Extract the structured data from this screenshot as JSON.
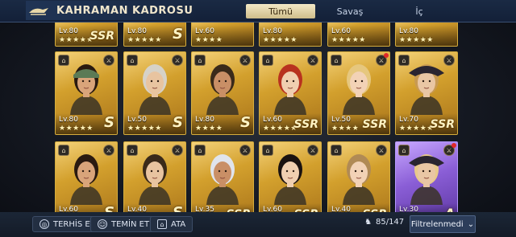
{
  "header": {
    "title": "KAHRAMAN KADROSU"
  },
  "tabs": [
    {
      "label": "Tümü",
      "active": true
    },
    {
      "label": "Savaş",
      "active": false
    },
    {
      "label": "İç",
      "active": false
    }
  ],
  "rows": [
    [
      {
        "level": "Lv.80",
        "stars": "★★★★★",
        "rank": "SSR",
        "color": "gold"
      },
      {
        "level": "Lv.80",
        "stars": "★★★★★",
        "rank": "S",
        "color": "gold"
      },
      {
        "level": "Lv.60",
        "stars": "★★★★",
        "rank": "",
        "color": "gold"
      },
      {
        "level": "Lv.80",
        "stars": "★★★★★",
        "rank": "",
        "color": "gold"
      },
      {
        "level": "Lv.60",
        "stars": "★★★★★",
        "rank": "",
        "color": "gold"
      },
      {
        "level": "Lv.80",
        "stars": "★★★★★",
        "rank": "",
        "color": "gold"
      }
    ],
    [
      {
        "level": "Lv.80",
        "stars": "★★★★★",
        "rank": "S",
        "color": "gold",
        "hair": "#2a1a10",
        "headwear": "bandana",
        "dot": false
      },
      {
        "level": "Lv.50",
        "stars": "★★★★★",
        "rank": "S",
        "color": "gold",
        "hair": "#d6d2c8",
        "headwear": "",
        "dot": false
      },
      {
        "level": "Lv.80",
        "stars": "★★★★",
        "rank": "S",
        "color": "gold",
        "hair": "#3a2a1a",
        "headwear": "",
        "dot": false
      },
      {
        "level": "Lv.60",
        "stars": "★★★★★",
        "rank": "SSR",
        "color": "gold",
        "hair": "#b8321f",
        "headwear": "",
        "dot": false
      },
      {
        "level": "Lv.50",
        "stars": "★★★★",
        "rank": "SSR",
        "color": "gold",
        "hair": "#e6c77e",
        "headwear": "",
        "dot": true
      },
      {
        "level": "Lv.70",
        "stars": "★★★★★",
        "rank": "SSR",
        "color": "gold",
        "hair": "#c89a52",
        "headwear": "tricorn",
        "dot": false
      }
    ],
    [
      {
        "level": "Lv.60",
        "stars": "★★★★★",
        "rank": "S",
        "color": "gold",
        "hair": "#2a1a10",
        "headwear": "",
        "dot": false
      },
      {
        "level": "Lv.40",
        "stars": "★★★★★",
        "rank": "S",
        "color": "gold",
        "hair": "#3a2a1a",
        "headwear": "",
        "dot": false
      },
      {
        "level": "Lv.35",
        "stars": "★★★★★",
        "rank": "SSR",
        "color": "gold",
        "hair": "#e0e4ec",
        "headwear": "",
        "dot": false
      },
      {
        "level": "Lv.60",
        "stars": "★★★★★",
        "rank": "SSR",
        "color": "gold",
        "hair": "#1a1210",
        "headwear": "",
        "dot": false
      },
      {
        "level": "Lv.40",
        "stars": "★★★★★",
        "rank": "SSR",
        "color": "gold",
        "hair": "#b08a55",
        "headwear": "",
        "dot": false
      },
      {
        "level": "Lv.30",
        "stars": "★★★★",
        "rank": "A",
        "color": "purple",
        "hair": "#e8c98a",
        "headwear": "tricorn",
        "dot": true
      }
    ]
  ],
  "footer": {
    "dismiss_label": "TERHİS ET",
    "recruit_label": "TEMİN ET",
    "assign_label": "ATA",
    "count": "85/147",
    "filter_label": "Filtrelenmedi"
  }
}
